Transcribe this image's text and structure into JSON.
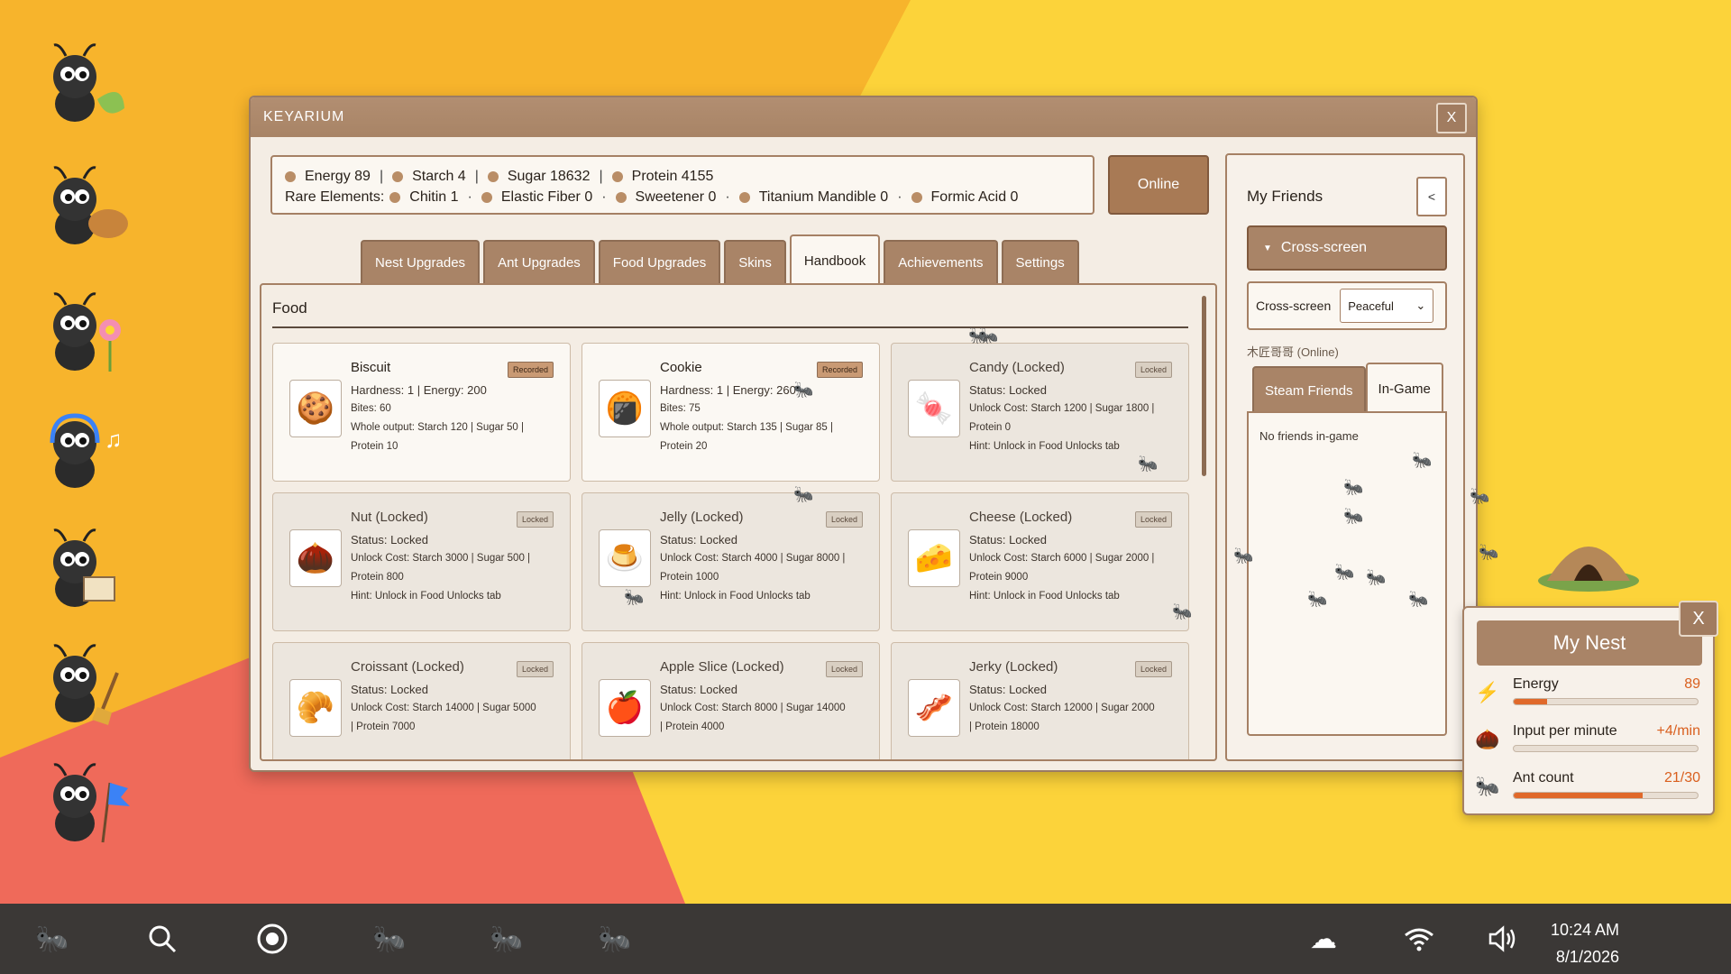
{
  "window": {
    "title": "KEYARIUM",
    "close_label": "X"
  },
  "resources": {
    "energy": "Energy 89",
    "starch": "Starch 4",
    "sugar": "Sugar 18632",
    "protein": "Protein 4155",
    "rare_label": "Rare Elements:",
    "chitin": "Chitin 1",
    "elastic_fiber": "Elastic Fiber 0",
    "sweetener": "Sweetener 0",
    "titanium": "Titanium Mandible 0",
    "formic": "Formic Acid 0",
    "sep_bar": "|",
    "sep_dot": "·"
  },
  "online_button": "Online",
  "tabs": [
    "Nest Upgrades",
    "Ant Upgrades",
    "Food Upgrades",
    "Skins",
    "Handbook",
    "Achievements",
    "Settings"
  ],
  "handbook": {
    "section": "Food",
    "cards": [
      {
        "icon": "cookie-icon",
        "glyph": "🍪",
        "name": "Biscuit",
        "badge": "Recorded",
        "locked": false,
        "l1": "Hardness: 1  |  Energy: 200",
        "l2": "Bites: 60",
        "l3": "Whole output: Starch 120  |  Sugar 50  |",
        "l4": "Protein 10"
      },
      {
        "icon": "cookie-icon",
        "glyph": "🍘",
        "name": "Cookie",
        "badge": "Recorded",
        "locked": false,
        "l1": "Hardness: 1  |  Energy: 260",
        "l2": "Bites: 75",
        "l3": "Whole output: Starch 135  |  Sugar 85  |",
        "l4": "Protein 20"
      },
      {
        "icon": "candy-icon",
        "glyph": "🍬",
        "name": "Candy (Locked)",
        "badge": "Locked",
        "locked": true,
        "l1": "Status: Locked",
        "l2": "Unlock Cost: Starch 1200  |  Sugar 1800  |",
        "l3": "Protein 0",
        "l4": "Hint: Unlock in Food Unlocks tab"
      },
      {
        "icon": "nut-icon",
        "glyph": "🌰",
        "name": "Nut (Locked)",
        "badge": "Locked",
        "locked": true,
        "l1": "Status: Locked",
        "l2": "Unlock Cost: Starch 3000  |  Sugar 500  |",
        "l3": "Protein 800",
        "l4": "Hint: Unlock in Food Unlocks tab"
      },
      {
        "icon": "jelly-icon",
        "glyph": "🍮",
        "name": "Jelly (Locked)",
        "badge": "Locked",
        "locked": true,
        "l1": "Status: Locked",
        "l2": "Unlock Cost: Starch 4000  |  Sugar 8000  |",
        "l3": "Protein 1000",
        "l4": "Hint: Unlock in Food Unlocks tab"
      },
      {
        "icon": "cheese-icon",
        "glyph": "🧀",
        "name": "Cheese (Locked)",
        "badge": "Locked",
        "locked": true,
        "l1": "Status: Locked",
        "l2": "Unlock Cost: Starch 6000  |  Sugar 2000  |",
        "l3": "Protein 9000",
        "l4": "Hint: Unlock in Food Unlocks tab"
      },
      {
        "icon": "croissant-icon",
        "glyph": "🥐",
        "name": "Croissant (Locked)",
        "badge": "Locked",
        "locked": true,
        "l1": "Status: Locked",
        "l2": "Unlock Cost: Starch 14000  |  Sugar 5000",
        "l3": "| Protein 7000",
        "l4": ""
      },
      {
        "icon": "apple-slice-icon",
        "glyph": "🍎",
        "name": "Apple Slice (Locked)",
        "badge": "Locked",
        "locked": true,
        "l1": "Status: Locked",
        "l2": "Unlock Cost: Starch 8000  |  Sugar 14000",
        "l3": "| Protein 4000",
        "l4": ""
      },
      {
        "icon": "jerky-icon",
        "glyph": "🥓",
        "name": "Jerky (Locked)",
        "badge": "Locked",
        "locked": true,
        "l1": "Status: Locked",
        "l2": "Unlock Cost: Starch 12000  |  Sugar 2000",
        "l3": "| Protein 18000",
        "l4": ""
      }
    ]
  },
  "friends": {
    "title": "My Friends",
    "back": "<",
    "dropdown": "Cross-screen",
    "mode_label": "Cross-screen",
    "mode_value": "Peaceful",
    "user": "木匠哥哥 (Online)",
    "tabs": [
      "Steam Friends",
      "In-Game"
    ],
    "empty": "No friends in-game"
  },
  "nest": {
    "title": "My Nest",
    "close": "X",
    "stats": [
      {
        "label": "Energy",
        "value": "89",
        "fill": 0.18,
        "icon": "energy-icon"
      },
      {
        "label": "Input per minute",
        "value": "+4/min",
        "fill": 0.0,
        "icon": "acorn-icon"
      },
      {
        "label": "Ant count",
        "value": "21/30",
        "fill": 0.7,
        "icon": "ant-icon"
      }
    ]
  },
  "taskbar": {
    "time": "10:24 AM",
    "date": "8/1/2026"
  },
  "colors": {
    "accent": "#a98467",
    "bg_orange": "#f7b42c",
    "bg_yellow": "#fcd33a",
    "bg_red": "#ef6a5a",
    "value": "#d95f1e"
  }
}
